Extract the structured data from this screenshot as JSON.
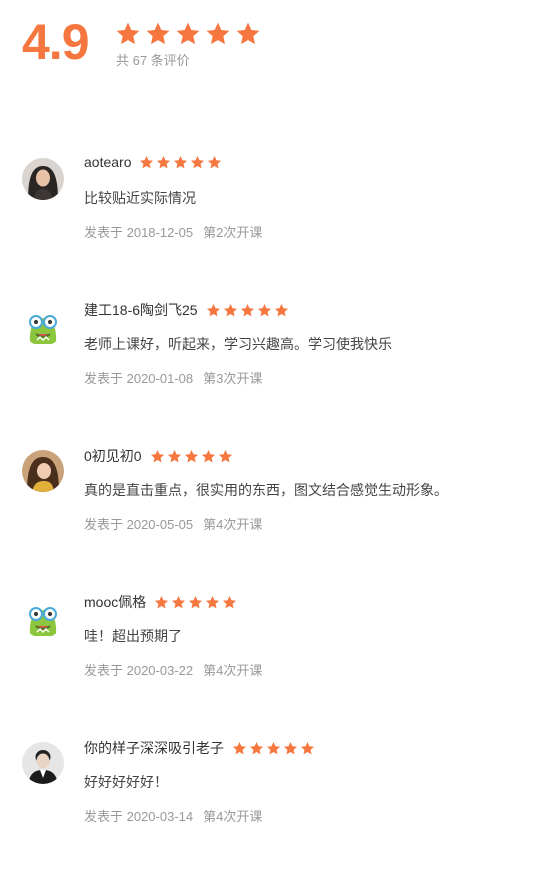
{
  "summary": {
    "score": "4.9",
    "rating": 5,
    "count_text": "共 67 条评价"
  },
  "colors": {
    "accent": "#f5773f",
    "muted": "#999999"
  },
  "reviews": [
    {
      "username": "aotearo",
      "rating": 5,
      "avatar": "photo-avatar-icon",
      "comment": "比较贴近实际情况",
      "date": "发表于 2018-12-05",
      "session": "第2次开课"
    },
    {
      "username": "建工18-6陶剑飞25",
      "rating": 5,
      "avatar": "default-monster-avatar-icon",
      "comment": "老师上课好，听起来，学习兴趣高。学习使我快乐",
      "date": "发表于 2020-01-08",
      "session": "第3次开课"
    },
    {
      "username": "0初见初0",
      "rating": 5,
      "avatar": "photo-avatar-icon",
      "comment": "真的是直击重点，很实用的东西，图文结合感觉生动形象。",
      "date": "发表于 2020-05-05",
      "session": "第4次开课"
    },
    {
      "username": "mooc佩格",
      "rating": 5,
      "avatar": "default-monster-avatar-icon",
      "comment": "哇！超出预期了",
      "date": "发表于 2020-03-22",
      "session": "第4次开课"
    },
    {
      "username": "你的样子深深吸引老子",
      "rating": 5,
      "avatar": "photo-avatar-icon",
      "comment": "好好好好好！",
      "date": "发表于 2020-03-14",
      "session": "第4次开课"
    }
  ]
}
